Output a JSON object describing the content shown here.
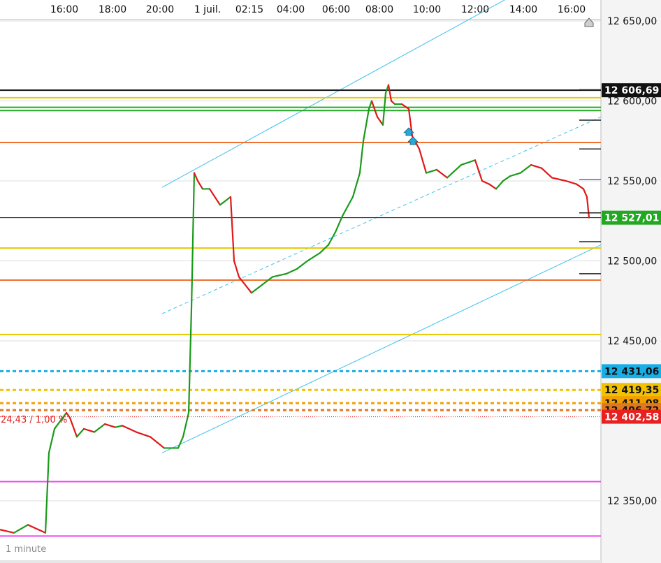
{
  "chart_data": {
    "type": "line",
    "timeframe_label": "1 minute",
    "x_ticks": [
      "16:00",
      "18:00",
      "20:00",
      "1 juil.",
      "02:15",
      "04:00",
      "06:00",
      "08:00",
      "10:00",
      "12:00",
      "14:00",
      "16:00"
    ],
    "y_ticks": [
      {
        "value": 12650,
        "label": "12 650,00"
      },
      {
        "value": 12600,
        "label": "12 600,00"
      },
      {
        "value": 12550,
        "label": "12 550,00"
      },
      {
        "value": 12500,
        "label": "12 500,00"
      },
      {
        "value": 12450,
        "label": "12 450,00"
      },
      {
        "value": 12350,
        "label": "12 350,00"
      }
    ],
    "ylim": [
      12321,
      12660
    ],
    "series": [
      {
        "x": [
          0,
          20,
          40,
          65,
          70,
          78,
          95,
          100,
          110,
          120,
          135,
          150,
          165,
          175,
          195,
          215,
          235,
          255,
          262,
          270,
          274,
          278,
          283,
          290,
          300,
          315,
          330,
          335,
          342,
          360,
          375,
          390,
          410,
          425,
          440,
          458,
          470,
          480,
          490,
          505,
          515,
          520,
          528,
          532,
          540,
          548,
          552,
          556,
          560,
          565,
          575,
          585,
          590,
          600,
          610,
          625,
          640,
          660,
          680,
          690,
          700,
          710,
          720,
          730,
          745,
          760,
          775,
          790,
          810,
          825,
          835,
          840,
          843
        ],
        "y": [
          12332,
          12330,
          12335,
          12330,
          12380,
          12395,
          12405,
          12402,
          12390,
          12395,
          12393,
          12398,
          12396,
          12397,
          12393,
          12390,
          12383,
          12383,
          12390,
          12405,
          12470,
          12555,
          12550,
          12545,
          12545,
          12535,
          12540,
          12500,
          12490,
          12480,
          12485,
          12490,
          12492,
          12495,
          12500,
          12505,
          12510,
          12518,
          12528,
          12540,
          12555,
          12575,
          12595,
          12600,
          12590,
          12585,
          12605,
          12610,
          12600,
          12598,
          12598,
          12595,
          12578,
          12570,
          12555,
          12557,
          12552,
          12560,
          12563,
          12550,
          12548,
          12545,
          12550,
          12553,
          12555,
          12560,
          12558,
          12552,
          12550,
          12548,
          12545,
          12540,
          12527
        ]
      }
    ],
    "horizontal_levels": [
      {
        "value": 12606.69,
        "label": "12 606,69",
        "color": "#111111",
        "style": "solid"
      },
      {
        "value": 12602,
        "label": "",
        "color": "#e8c800",
        "style": "solid"
      },
      {
        "value": 12596,
        "label": "",
        "color": "#22aa22",
        "style": "solid"
      },
      {
        "value": 12594,
        "label": "",
        "color": "#22aa22",
        "style": "solid"
      },
      {
        "value": 12574,
        "label": "",
        "color": "#f07030",
        "style": "solid"
      },
      {
        "value": 12527.01,
        "label": "12 527,01",
        "color": "#22a722",
        "style": "last-price"
      },
      {
        "value": 12508,
        "label": "",
        "color": "#e8c800",
        "style": "solid"
      },
      {
        "value": 12488,
        "label": "",
        "color": "#f07030",
        "style": "solid"
      },
      {
        "value": 12454,
        "label": "",
        "color": "#e8c800",
        "style": "solid"
      },
      {
        "value": 12431.06,
        "label": "12 431,06",
        "color": "#18aee6",
        "style": "dashed"
      },
      {
        "value": 12419.35,
        "label": "12 419,35",
        "color": "#f2c200",
        "style": "dashed"
      },
      {
        "value": 12411.08,
        "label": "12 411,08",
        "color": "#f2a000",
        "style": "dashed"
      },
      {
        "value": 12406.72,
        "label": "12 406,72",
        "color": "#e07820",
        "style": "dashed"
      },
      {
        "value": 12402.58,
        "label": "12 402,58",
        "color": "#e82020",
        "style": "dotted"
      },
      {
        "value": 12362,
        "label": "",
        "color": "#ee44ee",
        "style": "solid"
      },
      {
        "value": 12328,
        "label": "",
        "color": "#ee44ee",
        "style": "solid"
      }
    ],
    "channel_lines": [
      {
        "x1": 232,
        "y1": 12546,
        "x2": 730,
        "y2": 12665,
        "style": "solid"
      },
      {
        "x1": 232,
        "y1": 12467,
        "x2": 860,
        "y2": 12590,
        "style": "dashed"
      },
      {
        "x1": 232,
        "y1": 12380,
        "x2": 860,
        "y2": 12510,
        "style": "solid"
      }
    ],
    "annotation": "24,43 / 1,00 %",
    "colors": {
      "up": "#1a9a1a",
      "down": "#e01818",
      "channel": "#40c0ee",
      "grid": "#dcdcdc"
    }
  }
}
